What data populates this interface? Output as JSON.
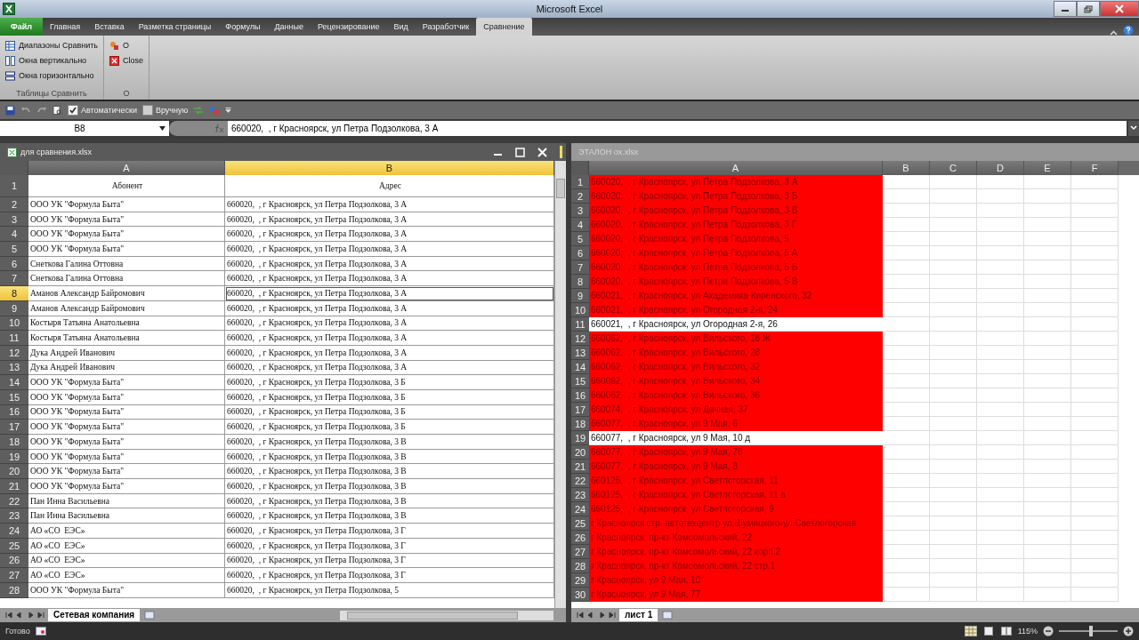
{
  "window": {
    "title": "Microsoft Excel"
  },
  "ribbon_tabs": [
    {
      "label": "Файл",
      "selected": false,
      "kind": "file"
    },
    {
      "label": "Главная",
      "selected": false,
      "kind": "tab"
    },
    {
      "label": "Вставка",
      "selected": false,
      "kind": "tab"
    },
    {
      "label": "Разметка страницы",
      "selected": false,
      "kind": "tab"
    },
    {
      "label": "Формулы",
      "selected": false,
      "kind": "tab"
    },
    {
      "label": "Данные",
      "selected": false,
      "kind": "tab"
    },
    {
      "label": "Рецензирование",
      "selected": false,
      "kind": "tab"
    },
    {
      "label": "Вид",
      "selected": false,
      "kind": "tab"
    },
    {
      "label": "Разработчик",
      "selected": false,
      "kind": "tab"
    },
    {
      "label": "Сравнение",
      "selected": true,
      "kind": "tab"
    }
  ],
  "ribbon_groups": [
    {
      "label": "Таблицы Сравнить",
      "buttons": [
        {
          "label": "Диапазоны Сравнить",
          "kind": "ranges"
        },
        {
          "label": "Окна вертикально",
          "kind": "vertical"
        },
        {
          "label": "Окна горизонтально",
          "kind": "horizontal"
        }
      ]
    },
    {
      "label": "О",
      "buttons": [
        {
          "label": "О",
          "kind": "about"
        },
        {
          "label": "Close",
          "kind": "close"
        }
      ]
    }
  ],
  "quick_access": {
    "checkboxes": [
      {
        "label": "Автоматически",
        "checked": true
      },
      {
        "label": "Вручную",
        "checked": false
      }
    ]
  },
  "formula_bar": {
    "name_box": "B8",
    "formula": "660020,  , г Красноярск, ул Петра Подзолкова, 3 А"
  },
  "left_window": {
    "title": "для сравнения.xlsx",
    "columns": [
      {
        "label": "A",
        "selected": false
      },
      {
        "label": "B",
        "selected": true
      }
    ],
    "rows": [
      {
        "number": "1",
        "selected": false,
        "cells": [
          "Абонент",
          "Адрес"
        ]
      },
      {
        "number": "2",
        "selected": false,
        "cells": [
          "ООО УК \"Формула Быта\"",
          "660020,  , г Красноярск, ул Петра Подзолкова, 3 А"
        ]
      },
      {
        "number": "3",
        "selected": false,
        "cells": [
          "ООО УК \"Формула Быта\"",
          "660020,  , г Красноярск, ул Петра Подзолкова, 3 А"
        ]
      },
      {
        "number": "4",
        "selected": false,
        "cells": [
          "ООО УК \"Формула Быта\"",
          "660020,  , г Красноярск, ул Петра Подзолкова, 3 А"
        ]
      },
      {
        "number": "5",
        "selected": false,
        "cells": [
          "ООО УК \"Формула Быта\"",
          "660020,  , г Красноярск, ул Петра Подзолкова, 3 А"
        ]
      },
      {
        "number": "6",
        "selected": false,
        "cells": [
          "Снеткова Галина Оттовна",
          "660020,  , г Красноярск, ул Петра Подзолкова, 3 А"
        ]
      },
      {
        "number": "7",
        "selected": false,
        "cells": [
          "Снеткова Галина Оттовна",
          "660020,  , г Красноярск, ул Петра Подзолкова, 3 А"
        ]
      },
      {
        "number": "8",
        "selected": true,
        "cells": [
          "Аманов Александр Байромович",
          "660020,  , г Красноярск, ул Петра Подзолкова, 3 А"
        ]
      },
      {
        "number": "9",
        "selected": false,
        "cells": [
          "Аманов Александр Байромович",
          "660020,  , г Красноярск, ул Петра Подзолкова, 3 А"
        ]
      },
      {
        "number": "10",
        "selected": false,
        "cells": [
          "Костыря Татьяна Анатольевна",
          "660020,  , г Красноярск, ул Петра Подзолкова, 3 А"
        ]
      },
      {
        "number": "11",
        "selected": false,
        "cells": [
          "Костыря Татьяна Анатольевна",
          "660020,  , г Красноярск, ул Петра Подзолкова, 3 А"
        ]
      },
      {
        "number": "12",
        "selected": false,
        "cells": [
          "Дука Андрей Иванович",
          "660020,  , г Красноярск, ул Петра Подзолкова, 3 А"
        ]
      },
      {
        "number": "13",
        "selected": false,
        "cells": [
          "Дука Андрей Иванович",
          "660020,  , г Красноярск, ул Петра Подзолкова, 3 А"
        ]
      },
      {
        "number": "14",
        "selected": false,
        "cells": [
          "ООО УК \"Формула Быта\"",
          "660020,  , г Красноярск, ул Петра Подзолкова, 3 Б"
        ]
      },
      {
        "number": "15",
        "selected": false,
        "cells": [
          "ООО УК \"Формула Быта\"",
          "660020,  , г Красноярск, ул Петра Подзолкова, 3 Б"
        ]
      },
      {
        "number": "16",
        "selected": false,
        "cells": [
          "ООО УК \"Формула Быта\"",
          "660020,  , г Красноярск, ул Петра Подзолкова, 3 Б"
        ]
      },
      {
        "number": "17",
        "selected": false,
        "cells": [
          "ООО УК \"Формула Быта\"",
          "660020,  , г Красноярск, ул Петра Подзолкова, 3 Б"
        ]
      },
      {
        "number": "18",
        "selected": false,
        "cells": [
          "ООО УК \"Формула Быта\"",
          "660020,  , г Красноярск, ул Петра Подзолкова, 3 В"
        ]
      },
      {
        "number": "19",
        "selected": false,
        "cells": [
          "ООО УК \"Формула Быта\"",
          "660020,  , г Красноярск, ул Петра Подзолкова, 3 В"
        ]
      },
      {
        "number": "20",
        "selected": false,
        "cells": [
          "ООО УК \"Формула Быта\"",
          "660020,  , г Красноярск, ул Петра Подзолкова, 3 В"
        ]
      },
      {
        "number": "21",
        "selected": false,
        "cells": [
          "ООО УК \"Формула Быта\"",
          "660020,  , г Красноярск, ул Петра Подзолкова, 3 В"
        ]
      },
      {
        "number": "22",
        "selected": false,
        "cells": [
          "Пан Инна Васильевна",
          "660020,  , г Красноярск, ул Петра Подзолкова, 3 В"
        ]
      },
      {
        "number": "23",
        "selected": false,
        "cells": [
          "Пан Инна Васильевна",
          "660020,  , г Красноярск, ул Петра Подзолкова, 3 В"
        ]
      },
      {
        "number": "24",
        "selected": false,
        "cells": [
          "АО «СО  ЕЭС»",
          "660020,  , г Красноярск, ул Петра Подзолкова, 3 Г"
        ]
      },
      {
        "number": "25",
        "selected": false,
        "cells": [
          "АО «СО  ЕЭС»",
          "660020,  , г Красноярск, ул Петра Подзолкова, 3 Г"
        ]
      },
      {
        "number": "26",
        "selected": false,
        "cells": [
          "АО «СО  ЕЭС»",
          "660020,  , г Красноярск, ул Петра Подзолкова, 3 Г"
        ]
      },
      {
        "number": "27",
        "selected": false,
        "cells": [
          "АО «СО  ЕЭС»",
          "660020,  , г Красноярск, ул Петра Подзолкова, 3 Г"
        ]
      },
      {
        "number": "28",
        "selected": false,
        "cells": [
          "ООО УК \"Формула Быта\"",
          "660020,  , г Красноярск, ул Петра Подзолкова, 5"
        ]
      }
    ],
    "sheet_tab": "Сетевая компания"
  },
  "right_window": {
    "title": "ЭТАЛОН ох.xlsx",
    "columns": [
      {
        "label": "A",
        "selected": false
      },
      {
        "label": "B",
        "selected": false
      },
      {
        "label": "C",
        "selected": false
      },
      {
        "label": "D",
        "selected": false
      },
      {
        "label": "E",
        "selected": false
      },
      {
        "label": "F",
        "selected": false
      }
    ],
    "rows": [
      {
        "number": "1",
        "highlighted": true,
        "text": "660020,  , г Красноярск, ул Петра Подзолкова, 3 А"
      },
      {
        "number": "2",
        "highlighted": true,
        "text": "660020,  , г Красноярск, ул Петра Подзолкова, 3 Б"
      },
      {
        "number": "3",
        "highlighted": true,
        "text": "660020,  , г Красноярск, ул Петра Подзолкова, 3 В"
      },
      {
        "number": "4",
        "highlighted": true,
        "text": "660020,  , г Красноярск, ул Петра Подзолкова, 3 Г"
      },
      {
        "number": "5",
        "highlighted": true,
        "text": "660020,  , г Красноярск, ул Петра Подзолкова, 5"
      },
      {
        "number": "6",
        "highlighted": true,
        "text": "660020,  , г Красноярск, ул Петра Подзолкова, 5 А"
      },
      {
        "number": "7",
        "highlighted": true,
        "text": "660020,  , г Красноярск, ул Петра Подзолкова, 5 Б"
      },
      {
        "number": "8",
        "highlighted": true,
        "text": "660020,  , г Красноярск, ул Петра Подзолкова, 5 В"
      },
      {
        "number": "9",
        "highlighted": true,
        "text": "660021,  , г Красноярск, ул Академика Киренского, 32"
      },
      {
        "number": "10",
        "highlighted": true,
        "text": "660021,  , г Красноярск, ул Огородная 2-я, 24"
      },
      {
        "number": "11",
        "highlighted": false,
        "text": "660021,  , г Красноярск, ул Огородная 2-я, 26"
      },
      {
        "number": "12",
        "highlighted": true,
        "text": "660062,  , г Красноярск, ул Вильского, 18 Ж"
      },
      {
        "number": "13",
        "highlighted": true,
        "text": "660062,  , г Красноярск, ул Вильского, 28"
      },
      {
        "number": "14",
        "highlighted": true,
        "text": "660062,  , г Красноярск, ул Вильского, 32"
      },
      {
        "number": "15",
        "highlighted": true,
        "text": "660062,  , г Красноярск, ул Вильского, 34"
      },
      {
        "number": "16",
        "highlighted": true,
        "text": "660062,  , г Красноярск, ул Вильского, 36"
      },
      {
        "number": "17",
        "highlighted": true,
        "text": "660074,  , г Красноярск, ул Дачная, 37"
      },
      {
        "number": "18",
        "highlighted": true,
        "text": "660077,  , г Красноярск, ул 9 Мая, 6"
      },
      {
        "number": "19",
        "highlighted": false,
        "text": "660077,  , г Красноярск, ул 9 Мая, 10 д"
      },
      {
        "number": "20",
        "highlighted": true,
        "text": "660077,  , г Красноярск, ул 9 Мая, 70"
      },
      {
        "number": "21",
        "highlighted": true,
        "text": "660077,  , г Красноярск, ул 9 Мая, 8"
      },
      {
        "number": "22",
        "highlighted": true,
        "text": "660125,  , г Красноярск, ул Светлогорская, 11"
      },
      {
        "number": "23",
        "highlighted": true,
        "text": "660125,  , г Красноярск, ул Светлогорская, 11 а"
      },
      {
        "number": "24",
        "highlighted": true,
        "text": "660125,  , г Красноярск, ул Светлогорская, 9"
      },
      {
        "number": "25",
        "highlighted": true,
        "text": "г Красноярск стр. автотехцентр ул.Шумяцкого-ул.Светлогорская"
      },
      {
        "number": "26",
        "highlighted": true,
        "text": "г Красноярск, пр-кт Комсомольский, 22"
      },
      {
        "number": "27",
        "highlighted": true,
        "text": "г Красноярск, пр-кт Комсомольский, 22 корп.2"
      },
      {
        "number": "28",
        "highlighted": true,
        "text": "г Красноярск, пр-кт Комсомольский, 22 стр.1"
      },
      {
        "number": "29",
        "highlighted": true,
        "text": "г Красноярск, ул 9 Мая, 10"
      },
      {
        "number": "30",
        "highlighted": true,
        "text": "г Красноярск, ул 9 Мая, 77"
      }
    ],
    "sheet_tab": "лист 1"
  },
  "status_bar": {
    "status": "Готово",
    "zoom": "115%",
    "zoom_slider": {
      "level": 0.55
    }
  }
}
